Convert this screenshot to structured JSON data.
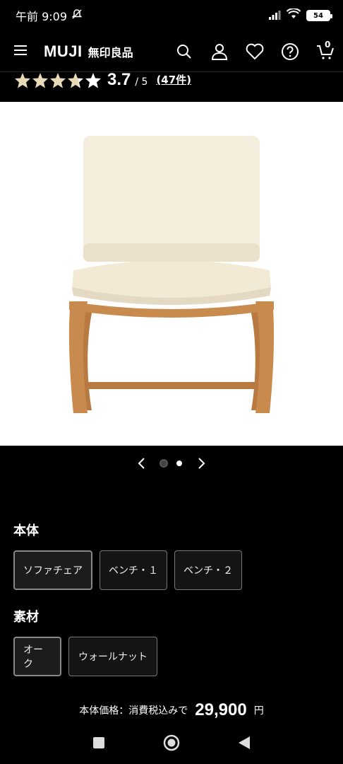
{
  "status": {
    "time": "午前 9:09",
    "battery": "54"
  },
  "header": {
    "brand": "MUJI",
    "brand_jp": "無印良品",
    "cart_count": "0",
    "icons": [
      "menu-icon",
      "search-icon",
      "account-icon",
      "favorite-icon",
      "help-icon",
      "cart-icon"
    ]
  },
  "rating": {
    "stars": 3.7,
    "max": 5,
    "score": "3.7",
    "total": "/ 5",
    "count": "(47件)"
  },
  "carousel": {
    "slides": 2,
    "active_index": 1
  },
  "body_group": {
    "label": "本体",
    "options": [
      "ソファチェア",
      "ベンチ・１",
      "ベンチ・２"
    ],
    "selected": "ソファチェア"
  },
  "material_group": {
    "label": "素材",
    "options": [
      "オーク",
      "ウォールナット"
    ],
    "selected": "オーク"
  },
  "price": {
    "label": "本体価格：消費税込みで",
    "value": "29,900",
    "unit": "円"
  },
  "colors": {
    "background": "#000000",
    "cushion": "#f6eedc",
    "wood": "#c98a4e"
  }
}
